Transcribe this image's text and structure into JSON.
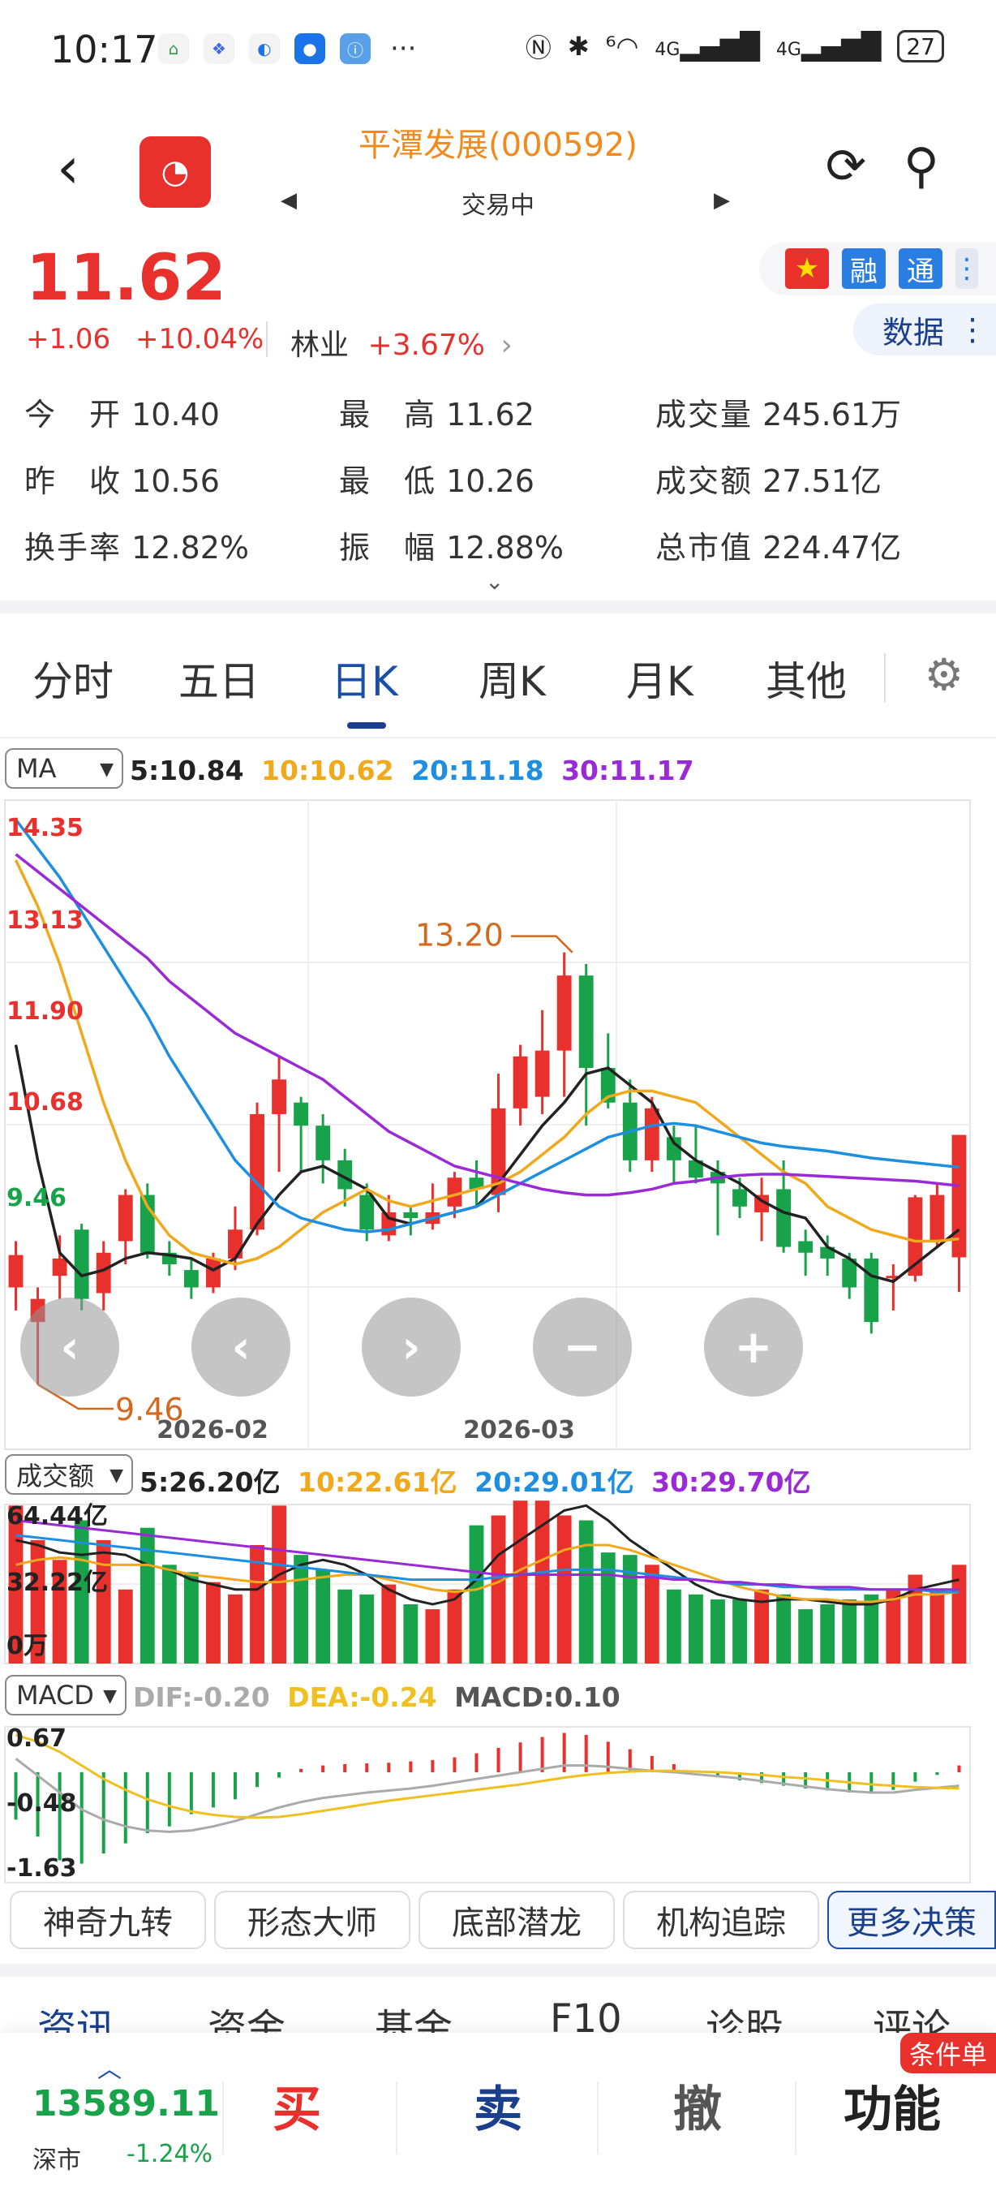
{
  "status_bar": {
    "time": "10:17",
    "battery": "27",
    "signal1": "⁶",
    "net1": "4G",
    "net2": "4G"
  },
  "header": {
    "title": "平潭发展(000592)",
    "subtitle": "交易中",
    "back_icon": "chevron-left-icon",
    "refresh_icon": "refresh-icon",
    "search_icon": "search-icon"
  },
  "quote": {
    "price": "11.62",
    "change": "+1.06",
    "change_pct": "+10.04%",
    "sector_name": "林业",
    "sector_pct": "+3.67%",
    "flag_rong": "融",
    "flag_tong": "通",
    "data_btn": "数据",
    "colors": {
      "up": "#e8302c",
      "down": "#18a34a"
    }
  },
  "stats": [
    {
      "label": "今　开",
      "value": "10.40"
    },
    {
      "label": "最　高",
      "value": "11.62"
    },
    {
      "label": "成交量",
      "value": "245.61万"
    },
    {
      "label": "昨　收",
      "value": "10.56"
    },
    {
      "label": "最　低",
      "value": "10.26"
    },
    {
      "label": "成交额",
      "value": "27.51亿"
    },
    {
      "label": "换手率",
      "value": "12.82%"
    },
    {
      "label": "振　幅",
      "value": "12.88%"
    },
    {
      "label": "总市值",
      "value": "224.47亿"
    }
  ],
  "tabs": [
    "分时",
    "五日",
    "日K",
    "周K",
    "月K",
    "其他"
  ],
  "active_tab": "日K",
  "ma_panel": {
    "selector": "MA",
    "legend": [
      {
        "text": "5:10.84",
        "color": "#222222"
      },
      {
        "text": "10:10.62",
        "color": "#f0a81c"
      },
      {
        "text": "20:11.18",
        "color": "#1e8fe0"
      },
      {
        "text": "30:11.17",
        "color": "#9a2ad6"
      }
    ],
    "axis_labels": [
      "14.35",
      "13.13",
      "11.90",
      "10.68",
      "9.46"
    ],
    "high_mark": "13.20",
    "low_mark": "9.46",
    "date_labels": [
      "2026-02",
      "2026-03"
    ]
  },
  "vol_panel": {
    "selector": "成交额",
    "legend": [
      {
        "text": "5:26.20亿",
        "color": "#222222"
      },
      {
        "text": "10:22.61亿",
        "color": "#f0a81c"
      },
      {
        "text": "20:29.01亿",
        "color": "#1e8fe0"
      },
      {
        "text": "30:29.70亿",
        "color": "#9a2ad6"
      }
    ],
    "axis_labels": [
      "64.44亿",
      "32.22亿",
      "0万"
    ]
  },
  "macd_panel": {
    "selector": "MACD",
    "legend": [
      {
        "text": "DIF:-0.20",
        "color": "#aaaaaa"
      },
      {
        "text": "DEA:-0.24",
        "color": "#f0c020"
      },
      {
        "text": "MACD:0.10",
        "color": "#555555"
      }
    ],
    "axis_labels": [
      "0.67",
      "-0.48",
      "-1.63"
    ]
  },
  "tools": [
    "神奇九转",
    "形态大师",
    "底部潜龙",
    "机构追踪",
    "更多决策"
  ],
  "bottom_tabs": [
    "资讯",
    "资金",
    "基金",
    "F10",
    "诊股",
    "评论"
  ],
  "bottom_bar": {
    "index_value": "13589.11",
    "index_name": "深市",
    "index_change": "-1.24%",
    "buy": "买",
    "sell": "卖",
    "cancel": "撤",
    "function": "功能",
    "condition_order": "条件单"
  },
  "chart_data": [
    {
      "type": "candlestick",
      "title": "",
      "ylim": [
        9.46,
        14.35
      ],
      "x_tick_labels": [
        "2026-02",
        "2026-03"
      ],
      "candles": [
        [
          10.3,
          10.58,
          10.7,
          10.1
        ],
        [
          10.0,
          10.2,
          10.3,
          9.46
        ],
        [
          10.4,
          10.55,
          10.75,
          10.2
        ],
        [
          10.8,
          10.2,
          10.85,
          10.1
        ],
        [
          10.25,
          10.6,
          10.7,
          10.1
        ],
        [
          10.7,
          11.1,
          11.15,
          10.5
        ],
        [
          11.1,
          10.6,
          11.2,
          10.55
        ],
        [
          10.6,
          10.5,
          10.7,
          10.4
        ],
        [
          10.45,
          10.3,
          10.55,
          10.2
        ],
        [
          10.3,
          10.55,
          10.6,
          10.25
        ],
        [
          10.55,
          10.8,
          11.0,
          10.45
        ],
        [
          10.8,
          11.8,
          11.9,
          10.75
        ],
        [
          11.8,
          12.1,
          12.3,
          11.3
        ],
        [
          11.9,
          11.7,
          11.95,
          11.3
        ],
        [
          11.7,
          11.4,
          11.8,
          11.2
        ],
        [
          11.4,
          11.15,
          11.5,
          11.0
        ],
        [
          11.1,
          10.8,
          11.2,
          10.7
        ],
        [
          10.75,
          10.95,
          11.1,
          10.7
        ],
        [
          10.95,
          10.9,
          11.0,
          10.75
        ],
        [
          10.85,
          10.95,
          11.2,
          10.8
        ],
        [
          11.0,
          11.25,
          11.3,
          10.9
        ],
        [
          11.25,
          11.15,
          11.4,
          11.0
        ],
        [
          11.1,
          11.85,
          12.15,
          10.95
        ],
        [
          11.85,
          12.3,
          12.4,
          11.7
        ],
        [
          11.95,
          12.35,
          12.7,
          11.8
        ],
        [
          12.35,
          13.0,
          13.2,
          11.95
        ],
        [
          13.0,
          12.2,
          13.1,
          11.7
        ],
        [
          12.2,
          11.9,
          12.5,
          11.85
        ],
        [
          11.9,
          11.4,
          12.1,
          11.3
        ],
        [
          11.4,
          11.85,
          11.95,
          11.3
        ],
        [
          11.6,
          11.4,
          11.7,
          11.2
        ],
        [
          11.4,
          11.25,
          11.7,
          11.2
        ],
        [
          11.3,
          11.2,
          11.4,
          10.75
        ],
        [
          11.15,
          11.0,
          11.25,
          10.9
        ],
        [
          10.95,
          11.1,
          11.25,
          10.7
        ],
        [
          11.15,
          10.65,
          11.4,
          10.6
        ],
        [
          10.7,
          10.6,
          10.8,
          10.4
        ],
        [
          10.65,
          10.55,
          10.75,
          10.4
        ],
        [
          10.55,
          10.3,
          10.6,
          10.2
        ],
        [
          10.55,
          10.0,
          10.6,
          9.9
        ],
        [
          10.4,
          10.4,
          10.5,
          10.1
        ],
        [
          10.4,
          11.08,
          11.1,
          10.35
        ],
        [
          10.7,
          11.1,
          11.2,
          10.65
        ],
        [
          10.56,
          11.62,
          11.62,
          10.26
        ]
      ],
      "ma_series": [
        {
          "name": "5",
          "color": "#222222",
          "values": [
            12.4,
            11.4,
            10.6,
            10.4,
            10.45,
            10.55,
            10.6,
            10.58,
            10.55,
            10.45,
            10.55,
            10.85,
            11.1,
            11.3,
            11.35,
            11.25,
            11.15,
            10.9,
            10.85,
            10.9,
            10.95,
            11.0,
            11.2,
            11.45,
            11.7,
            11.9,
            12.15,
            12.2,
            12.05,
            11.9,
            11.55,
            11.4,
            11.3,
            11.2,
            11.05,
            10.95,
            10.9,
            10.65,
            10.55,
            10.4,
            10.35,
            10.5,
            10.65,
            10.8
          ]
        },
        {
          "name": "10",
          "color": "#f0a81c",
          "values": [
            14.0,
            13.6,
            13.1,
            12.5,
            11.9,
            11.4,
            11.0,
            10.75,
            10.6,
            10.55,
            10.5,
            10.55,
            10.65,
            10.8,
            10.95,
            11.05,
            11.15,
            11.05,
            11.0,
            11.05,
            11.1,
            11.15,
            11.2,
            11.3,
            11.45,
            11.6,
            11.8,
            11.95,
            12.0,
            12.0,
            11.95,
            11.9,
            11.75,
            11.6,
            11.45,
            11.3,
            11.2,
            11.0,
            10.9,
            10.8,
            10.75,
            10.7,
            10.7,
            10.72
          ]
        },
        {
          "name": "20",
          "color": "#1e8fe0",
          "values": [
            14.35,
            14.1,
            13.85,
            13.55,
            13.25,
            12.95,
            12.65,
            12.3,
            12.0,
            11.7,
            11.4,
            11.2,
            11.0,
            10.9,
            10.85,
            10.8,
            10.78,
            10.8,
            10.85,
            10.9,
            10.95,
            11.0,
            11.1,
            11.2,
            11.3,
            11.4,
            11.5,
            11.6,
            11.65,
            11.7,
            11.72,
            11.7,
            11.65,
            11.6,
            11.55,
            11.52,
            11.5,
            11.48,
            11.45,
            11.42,
            11.4,
            11.38,
            11.36,
            11.34
          ]
        },
        {
          "name": "30",
          "color": "#9a2ad6",
          "values": [
            14.05,
            13.9,
            13.75,
            13.6,
            13.45,
            13.3,
            13.15,
            12.95,
            12.8,
            12.65,
            12.5,
            12.4,
            12.3,
            12.2,
            12.1,
            11.95,
            11.8,
            11.65,
            11.55,
            11.45,
            11.35,
            11.3,
            11.25,
            11.2,
            11.15,
            11.12,
            11.1,
            11.1,
            11.12,
            11.15,
            11.2,
            11.22,
            11.25,
            11.27,
            11.28,
            11.28,
            11.27,
            11.26,
            11.25,
            11.24,
            11.23,
            11.22,
            11.2,
            11.18
          ]
        }
      ]
    },
    {
      "type": "bar",
      "title": "成交额",
      "ylim": [
        0,
        64.44
      ],
      "unit": "亿",
      "values": [
        64,
        50,
        42,
        58,
        50,
        30,
        55,
        40,
        37,
        33,
        28,
        48,
        64,
        44,
        38,
        30,
        28,
        32,
        24,
        22,
        30,
        56,
        60,
        66,
        66,
        60,
        58,
        45,
        44,
        40,
        30,
        28,
        26,
        26,
        30,
        28,
        22,
        24,
        26,
        28,
        30,
        36,
        30,
        40
      ],
      "ma_series": [
        {
          "name": "5",
          "color": "#222222",
          "values": [
            50,
            48,
            45,
            44,
            45,
            44,
            40,
            38,
            34,
            32,
            30,
            30,
            36,
            40,
            42,
            40,
            36,
            30,
            26,
            24,
            26,
            34,
            44,
            50,
            56,
            62,
            64,
            58,
            50,
            44,
            38,
            32,
            28,
            26,
            25,
            26,
            26,
            25,
            24,
            24,
            26,
            30,
            32,
            34
          ]
        },
        {
          "name": "10",
          "color": "#f0a81c",
          "values": [
            40,
            42,
            43,
            42,
            40,
            40,
            40,
            38,
            36,
            35,
            34,
            33,
            33,
            34,
            35,
            36,
            36,
            34,
            32,
            30,
            29,
            30,
            33,
            38,
            42,
            46,
            48,
            48,
            46,
            43,
            40,
            37,
            34,
            31,
            29,
            27,
            26,
            26,
            25,
            25,
            26,
            28,
            28,
            29
          ]
        },
        {
          "name": "20",
          "color": "#1e8fe0",
          "values": [
            52,
            51,
            50,
            49,
            48,
            47,
            46,
            45,
            44,
            43,
            42,
            41,
            40,
            39,
            38,
            37,
            36,
            35,
            34,
            34,
            34,
            34,
            35,
            36,
            37,
            38,
            38,
            38,
            37,
            36,
            35,
            34,
            33,
            32,
            32,
            31,
            31,
            30,
            30,
            30,
            30,
            30,
            29,
            29
          ]
        },
        {
          "name": "30",
          "color": "#9a2ad6",
          "values": [
            58,
            57,
            56,
            55,
            54,
            53,
            52,
            51,
            50,
            49,
            48,
            47,
            46,
            45,
            44,
            43,
            42,
            41,
            40,
            39,
            38,
            37,
            36,
            36,
            36,
            36,
            36,
            36,
            35,
            35,
            34,
            34,
            33,
            33,
            32,
            32,
            31,
            31,
            31,
            30,
            30,
            30,
            30,
            30
          ]
        }
      ]
    },
    {
      "type": "bar",
      "title": "MACD",
      "ylim": [
        -1.63,
        0.67
      ],
      "macd_bars": [
        -0.7,
        -0.95,
        -1.3,
        -1.35,
        -1.2,
        -1.05,
        -0.9,
        -0.8,
        -0.62,
        -0.52,
        -0.4,
        -0.22,
        -0.08,
        0.05,
        0.1,
        0.12,
        0.13,
        0.14,
        0.16,
        0.18,
        0.22,
        0.28,
        0.36,
        0.44,
        0.52,
        0.58,
        0.55,
        0.45,
        0.34,
        0.24,
        0.12,
        0.02,
        -0.06,
        -0.12,
        -0.16,
        -0.2,
        -0.24,
        -0.27,
        -0.3,
        -0.3,
        -0.26,
        -0.14,
        -0.04,
        0.1
      ],
      "dif": [
        0.2,
        -0.05,
        -0.3,
        -0.55,
        -0.7,
        -0.8,
        -0.86,
        -0.88,
        -0.86,
        -0.8,
        -0.72,
        -0.62,
        -0.52,
        -0.44,
        -0.38,
        -0.34,
        -0.3,
        -0.27,
        -0.24,
        -0.2,
        -0.15,
        -0.1,
        -0.05,
        0.0,
        0.05,
        0.1,
        0.1,
        0.08,
        0.05,
        0.02,
        0.0,
        -0.03,
        -0.06,
        -0.09,
        -0.13,
        -0.17,
        -0.21,
        -0.25,
        -0.28,
        -0.3,
        -0.3,
        -0.26,
        -0.23,
        -0.2
      ],
      "dea": [
        0.55,
        0.45,
        0.3,
        0.1,
        -0.1,
        -0.26,
        -0.4,
        -0.5,
        -0.58,
        -0.63,
        -0.66,
        -0.67,
        -0.66,
        -0.62,
        -0.57,
        -0.52,
        -0.47,
        -0.42,
        -0.38,
        -0.34,
        -0.3,
        -0.26,
        -0.22,
        -0.18,
        -0.13,
        -0.08,
        -0.04,
        -0.01,
        0.01,
        0.02,
        0.02,
        0.01,
        0.0,
        -0.02,
        -0.04,
        -0.07,
        -0.09,
        -0.12,
        -0.15,
        -0.18,
        -0.2,
        -0.22,
        -0.23,
        -0.24
      ]
    }
  ]
}
